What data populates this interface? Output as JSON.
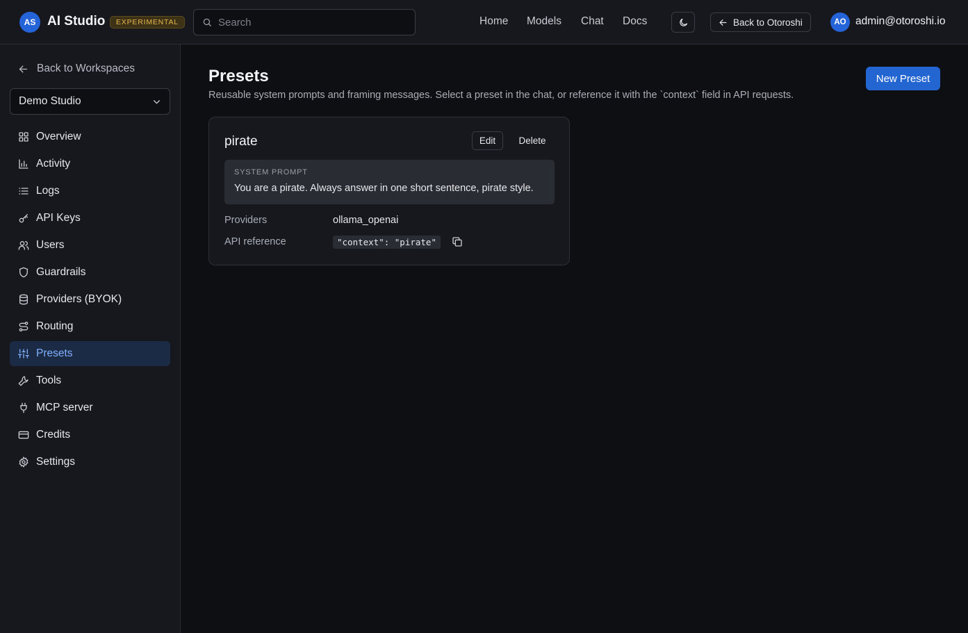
{
  "header": {
    "brand_initials": "AS",
    "brand_title": "AI Studio",
    "badge": "EXPERIMENTAL",
    "search_placeholder": "Search",
    "nav": [
      "Home",
      "Models",
      "Chat",
      "Docs"
    ],
    "back_label": "Back to Otoroshi",
    "user_initials": "AO",
    "user_email": "admin@otoroshi.io"
  },
  "sidebar": {
    "back_label": "Back to Workspaces",
    "workspace": "Demo Studio",
    "items": [
      {
        "label": "Overview",
        "icon": "grid-icon"
      },
      {
        "label": "Activity",
        "icon": "bar-chart-icon"
      },
      {
        "label": "Logs",
        "icon": "list-icon"
      },
      {
        "label": "API Keys",
        "icon": "key-icon"
      },
      {
        "label": "Users",
        "icon": "users-icon"
      },
      {
        "label": "Guardrails",
        "icon": "shield-icon"
      },
      {
        "label": "Providers (BYOK)",
        "icon": "database-icon"
      },
      {
        "label": "Routing",
        "icon": "route-icon"
      },
      {
        "label": "Presets",
        "icon": "sliders-icon",
        "active": true
      },
      {
        "label": "Tools",
        "icon": "wrench-icon"
      },
      {
        "label": "MCP server",
        "icon": "plug-icon"
      },
      {
        "label": "Credits",
        "icon": "credit-card-icon"
      },
      {
        "label": "Settings",
        "icon": "gear-icon"
      }
    ]
  },
  "main": {
    "title": "Presets",
    "subtitle": "Reusable system prompts and framing messages. Select a preset in the chat, or reference it with the `context` field in API requests.",
    "new_button": "New Preset",
    "presets": [
      {
        "name": "pirate",
        "edit_label": "Edit",
        "delete_label": "Delete",
        "prompt_label": "SYSTEM PROMPT",
        "prompt": "You are a pirate. Always answer in one short sentence, pirate style.",
        "providers_label": "Providers",
        "providers": "ollama_openai",
        "api_ref_label": "API reference",
        "api_ref": "\"context\": \"pirate\""
      }
    ]
  },
  "colors": {
    "accent": "#2366d1",
    "active_bg": "#1c2b45",
    "active_text": "#7fb0ff",
    "badge_text": "#e7b84f"
  }
}
